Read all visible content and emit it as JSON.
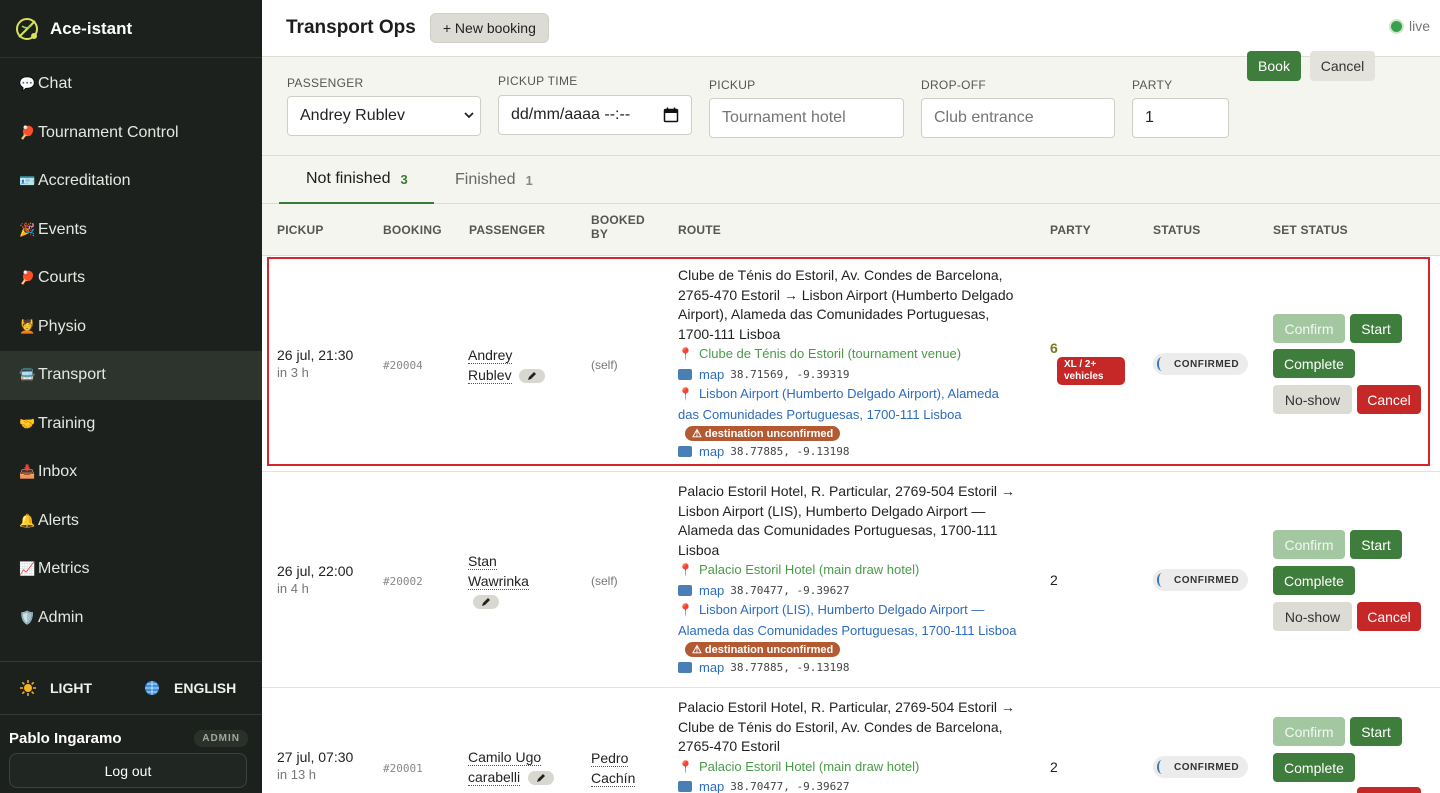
{
  "brand": {
    "name": "Ace-istant",
    "icon": "tennis-racket-logo-icon"
  },
  "nav": [
    {
      "label": "Chat",
      "icon": "💬"
    },
    {
      "label": "Tournament Control",
      "icon": "🏓"
    },
    {
      "label": "Accreditation",
      "icon": "🪪"
    },
    {
      "label": "Events",
      "icon": "🎉"
    },
    {
      "label": "Courts",
      "icon": "🏓"
    },
    {
      "label": "Physio",
      "icon": "💆"
    },
    {
      "label": "Transport",
      "icon": "🚍",
      "active": true
    },
    {
      "label": "Training",
      "icon": "🤝"
    },
    {
      "label": "Inbox",
      "icon": "📥"
    },
    {
      "label": "Alerts",
      "icon": "🔔"
    },
    {
      "label": "Metrics",
      "icon": "📈"
    },
    {
      "label": "Admin",
      "icon": "🛡️"
    }
  ],
  "toggles": {
    "theme": "LIGHT",
    "language": "ENGLISH"
  },
  "user": {
    "name": "Pablo Ingaramo",
    "role": "ADMIN",
    "logout": "Log out"
  },
  "header": {
    "title": "Transport Ops",
    "new_booking": "+ New booking",
    "live": "live",
    "live_color": "#3aa04a"
  },
  "form": {
    "passenger_label": "PASSENGER",
    "passenger_value": "Andrey Rublev",
    "pickup_time_label": "PICKUP TIME",
    "pickup_time_value": "dd/mm/aaaa --:--",
    "pickup_label": "PICKUP",
    "pickup_placeholder": "Tournament hotel",
    "dropoff_label": "DROP-OFF",
    "dropoff_placeholder": "Club entrance",
    "party_label": "PARTY",
    "party_value": "1",
    "book": "Book",
    "cancel": "Cancel"
  },
  "tabs": [
    {
      "label": "Not finished",
      "count": "3"
    },
    {
      "label": "Finished",
      "count": "1"
    }
  ],
  "columns": [
    "PICKUP",
    "BOOKING",
    "PASSENGER",
    "BOOKED BY",
    "ROUTE",
    "PARTY",
    "STATUS",
    "SET STATUS"
  ],
  "columns_bookedby": [
    "BOOKED",
    "BY"
  ],
  "actions": {
    "confirm": "Confirm",
    "start": "Start",
    "complete": "Complete",
    "noshow": "No-show",
    "cancel": "Cancel"
  },
  "rows": [
    {
      "time": "26 jul, 21:30",
      "rel": "in 3 h",
      "booking": "#20004",
      "pax1": "Andrey",
      "pax2": "Rublev",
      "booked_by": "(self)",
      "route": "Clube de Ténis do Estoril, Av. Condes de Barcelona, 2765-470 Estoril → Lisbon Airport (Humberto Delgado Airport), Alameda das Comunidades Portuguesas, 1700-111 Lisboa",
      "from": "Clube de Ténis do Estoril (tournament venue)",
      "from_map": "map",
      "from_coords": "38.71569, -9.39319",
      "to": "Lisbon Airport (Humberto Delgado Airport), Alameda das Comunidades Portuguesas, 1700-111 Lisboa",
      "warn": "⚠ destination unconfirmed",
      "to_map": "map",
      "to_coords": "38.77885, -9.13198",
      "party": "6",
      "party_flag": "XL / 2+ vehicles",
      "status": "CONFIRMED"
    },
    {
      "time": "26 jul, 22:00",
      "rel": "in 4 h",
      "booking": "#20002",
      "pax1": "Stan",
      "pax2": "Wawrinka",
      "booked_by": "(self)",
      "route": "Palacio Estoril Hotel, R. Particular, 2769-504 Estoril → Lisbon Airport (LIS), Humberto Delgado Airport — Alameda das Comunidades Portuguesas, 1700-111 Lisboa",
      "from": "Palacio Estoril Hotel (main draw hotel)",
      "from_map": "map",
      "from_coords": "38.70477, -9.39627",
      "to": "Lisbon Airport (LIS), Humberto Delgado Airport — Alameda das Comunidades Portuguesas, 1700-111 Lisboa",
      "warn": "⚠ destination unconfirmed",
      "to_map": "map",
      "to_coords": "38.77885, -9.13198",
      "party": "2",
      "status": "CONFIRMED"
    },
    {
      "time": "27 jul, 07:30",
      "rel": "in 13 h",
      "booking": "#20001",
      "pax1": "Camilo Ugo",
      "pax2": "carabelli",
      "booked_by1": "Pedro",
      "booked_by2": "Cachín",
      "route": "Palacio Estoril Hotel, R. Particular, 2769-504 Estoril → Clube de Ténis do Estoril, Av. Condes de Barcelona, 2765-470 Estoril",
      "from": "Palacio Estoril Hotel (main draw hotel)",
      "from_map": "map",
      "from_coords": "38.70477, -9.39627",
      "party": "2",
      "status": "CONFIRMED"
    }
  ]
}
